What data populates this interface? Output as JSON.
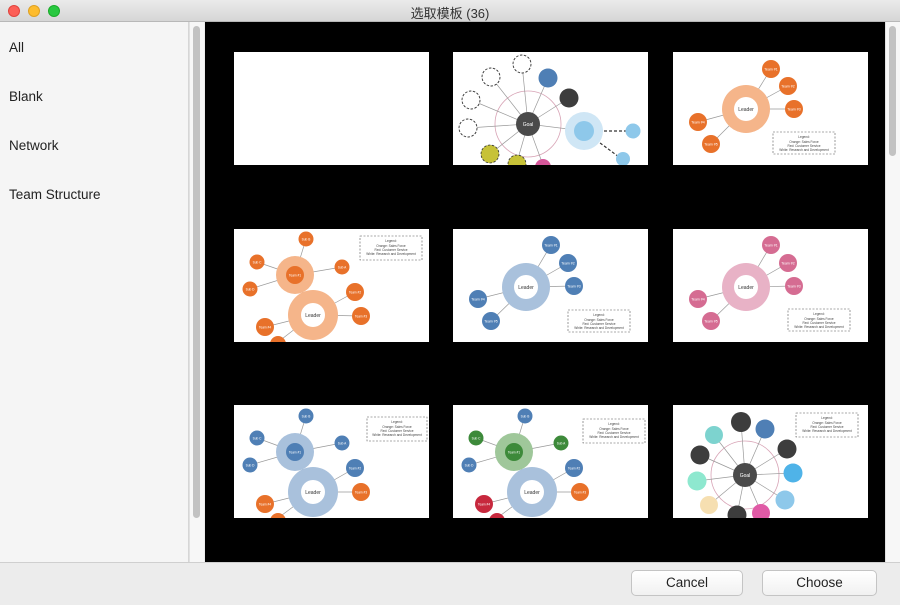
{
  "window": {
    "title": "选取模板 (36)"
  },
  "sidebar": {
    "items": [
      {
        "label": "All"
      },
      {
        "label": "Blank"
      },
      {
        "label": "Network"
      },
      {
        "label": "Team Structure"
      }
    ]
  },
  "templates": {
    "goal_label": "Goal",
    "leader_label": "Leader",
    "team1": "Team #1",
    "team2": "Team #2",
    "team3": "Team #3",
    "team4": "Team #4",
    "team5": "Team #5",
    "sub_a": "Sub A",
    "sub_b": "Sub B",
    "sub_c": "Sub C",
    "sub_d": "Sub D",
    "legend_title": "Legend:",
    "legend_line1": "Orange: Sales Force",
    "legend_line2": "Red: Customer Service",
    "legend_line3": "White: Research and Development"
  },
  "colors": {
    "orange": "#e8712a",
    "orange_ring": "#f5b58a",
    "blue": "#4f7fb5",
    "blue_ring": "#a9c1dc",
    "pink": "#d56c92",
    "pink_ring": "#e8b2c6",
    "green": "#3d8a3a",
    "green_ring": "#9fc79a",
    "dark": "#4a4a4a"
  },
  "footer": {
    "cancel_label": "Cancel",
    "choose_label": "Choose"
  }
}
